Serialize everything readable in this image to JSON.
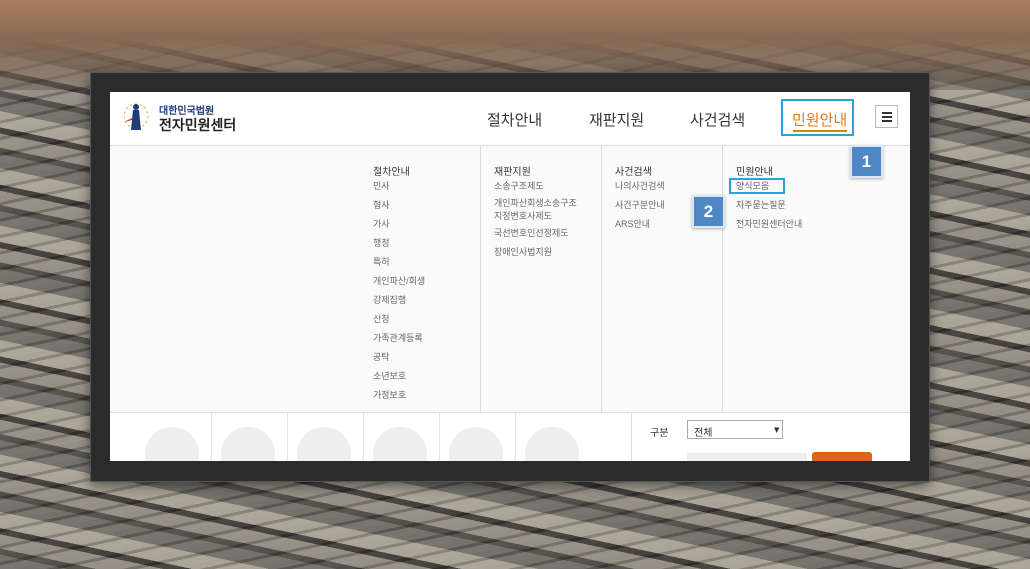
{
  "header": {
    "logo_top": "대한민국법원",
    "logo_main": "전자민원센터",
    "nav": [
      {
        "label": "절차안내"
      },
      {
        "label": "재판지원"
      },
      {
        "label": "사건검색"
      },
      {
        "label": "민원안내",
        "active": true
      }
    ],
    "menu_icon": "hamburger-icon"
  },
  "mega_menu": {
    "columns": [
      {
        "title": "절차안내",
        "items": [
          "민사",
          "형사",
          "가사",
          "행정",
          "특허",
          "개인파산/회생",
          "강제집행",
          "신청",
          "가족관계등록",
          "공탁",
          "소년보호",
          "가정보호"
        ]
      },
      {
        "title": "재판지원",
        "items": [
          "소송구조제도",
          "개인파산회생소송구조",
          "지정변호사제도",
          "국선변호인선정제도",
          "장애인사법지원"
        ]
      },
      {
        "title": "사건검색",
        "items": [
          "나의사건검색",
          "사건구분안내",
          "ARS안내"
        ]
      },
      {
        "title": "민원안내",
        "items": [
          "양식모음",
          "자주묻는질문",
          "전자민원센터안내"
        ]
      }
    ]
  },
  "callouts": [
    "1",
    "2"
  ],
  "bottom": {
    "filter_label": "구분",
    "filter_value": "전체"
  },
  "colors": {
    "accent": "#e07a1a",
    "highlight": "#2aa4d8",
    "callout": "#4f87c4"
  }
}
